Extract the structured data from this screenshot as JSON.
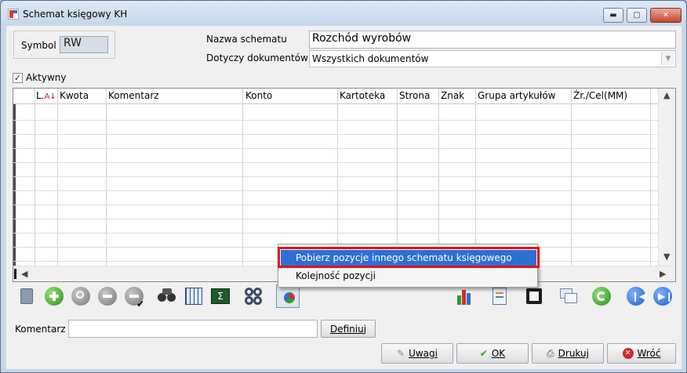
{
  "window": {
    "title": "Schemat księgowy KH",
    "min_glyph": "▬",
    "max_glyph": "▢",
    "close_glyph": "✕"
  },
  "header": {
    "symbol_label": "Symbol",
    "symbol_value": "RW",
    "name_label": "Nazwa schematu",
    "name_value": "Rozchód wyrobów",
    "docs_label": "Dotyczy dokumentów",
    "docs_value": "Wszystkich dokumentów",
    "active_label": "Aktywny",
    "active_checked": "✓"
  },
  "grid": {
    "columns": [
      "L.",
      "Kwota",
      "Komentarz",
      "Konto",
      "Kartoteka",
      "Strona",
      "Znak",
      "Grupa artykułów",
      "Źr./Cel(MM)"
    ],
    "sort_glyph": "A↓"
  },
  "context_menu": {
    "items": [
      {
        "label": "Pobierz pozycje innego schematu księgowego",
        "selected": true
      },
      {
        "label": "Kolejność pozycji",
        "selected": false
      }
    ]
  },
  "toolbar": {
    "icons": [
      "document-icon",
      "add-icon",
      "search-icon",
      "remove-icon",
      "delete-icon",
      "binoculars-icon",
      "calendar-grid-icon",
      "formula-icon",
      "gears-icon",
      "menu-chart-icon",
      "bar-chart-icon",
      "report-icon",
      "film-icon",
      "windows-icon",
      "refresh-icon",
      "first-icon",
      "last-icon"
    ]
  },
  "footer": {
    "comment_label": "Komentarz",
    "comment_value": "",
    "define_button": "Definiuj",
    "uwagi_button": "Uwagi",
    "ok_button": "OK",
    "drukuj_button": "Drukuj",
    "wroc_button": "Wróć"
  },
  "colors": {
    "accent": "#2e6fd4",
    "highlight_frame": "#e0121b",
    "ok_green": "#2aa02a",
    "back_red": "#cf2b2b"
  }
}
